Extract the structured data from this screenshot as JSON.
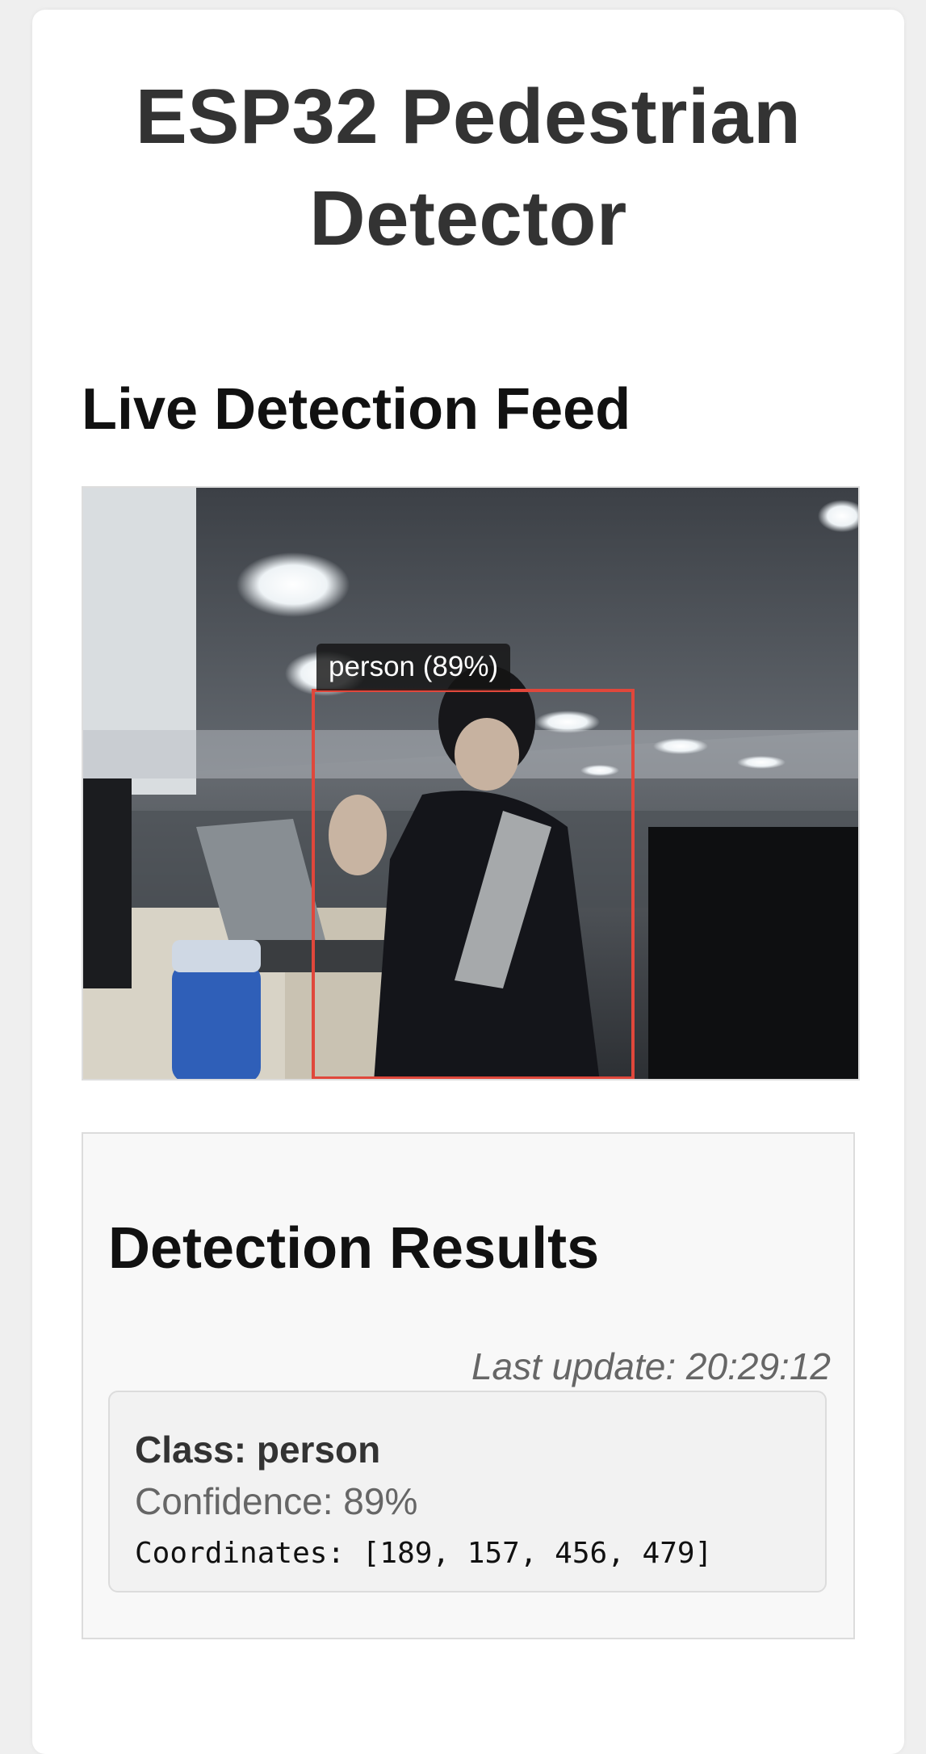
{
  "header": {
    "title_line1": "ESP32 Pedestrian",
    "title_line2": "Detector"
  },
  "feed": {
    "section_title": "Live Detection Feed",
    "overlay_label": "person (89%)",
    "box_color": "#e0473b"
  },
  "results": {
    "section_title": "Detection Results",
    "last_update": "Last update: 20:29:12",
    "detections": [
      {
        "class_text": "Class: person",
        "confidence_text": "Confidence: 89%",
        "coordinates_text": "Coordinates: [189, 157, 456, 479]"
      }
    ]
  }
}
